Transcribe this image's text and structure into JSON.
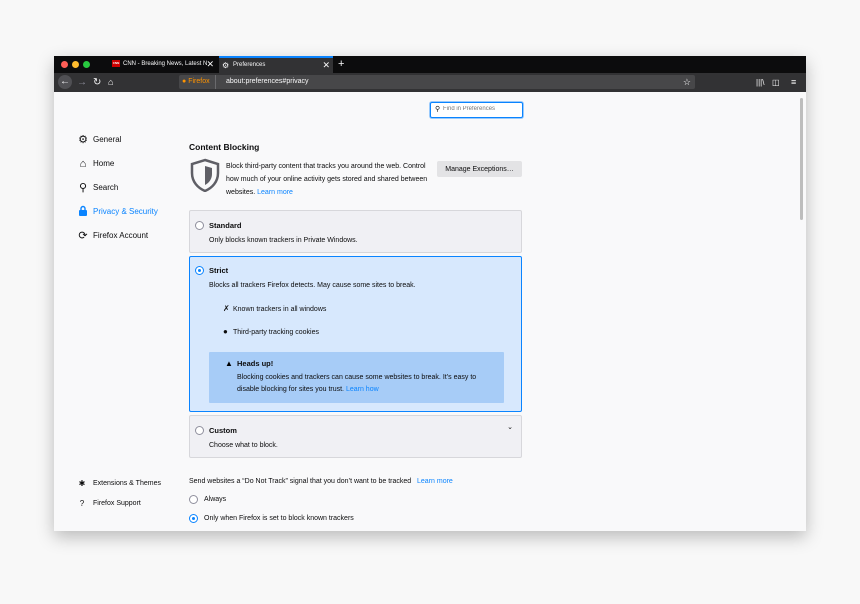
{
  "browser": {
    "tabs": [
      {
        "favicon": "CNN",
        "title": "CNN - Breaking News, Latest N"
      },
      {
        "title": "Preferences"
      }
    ],
    "new_tab": "+",
    "identity": "Firefox",
    "url": "about:preferences#privacy"
  },
  "search": {
    "placeholder": "Find in Preferences"
  },
  "sidebar": {
    "items": [
      {
        "label": "General",
        "icon": "gear-icon"
      },
      {
        "label": "Home",
        "icon": "home-icon"
      },
      {
        "label": "Search",
        "icon": "search-icon"
      },
      {
        "label": "Privacy & Security",
        "icon": "lock-icon"
      },
      {
        "label": "Firefox Account",
        "icon": "sync-icon"
      }
    ],
    "footer": [
      {
        "label": "Extensions & Themes",
        "icon": "puzzle-icon"
      },
      {
        "label": "Firefox Support",
        "icon": "help-icon"
      }
    ]
  },
  "content_blocking": {
    "title": "Content Blocking",
    "description": "Block third-party content that tracks you around the web. Control how much of your online activity gets stored and shared between websites.",
    "learn_more": "Learn more",
    "manage_button": "Manage Exceptions…",
    "standard": {
      "title": "Standard",
      "desc": "Only blocks known trackers in Private Windows."
    },
    "strict": {
      "title": "Strict",
      "desc": "Blocks all trackers Firefox detects. May cause some sites to break.",
      "features": [
        "Known trackers in all windows",
        "Third-party tracking cookies"
      ],
      "warning_title": "Heads up!",
      "warning_text": "Blocking cookies and trackers can cause some websites to break. It’s easy to disable blocking for sites you trust.",
      "warning_link": "Learn how"
    },
    "custom": {
      "title": "Custom",
      "desc": "Choose what to block."
    }
  },
  "dnt": {
    "label": "Send websites a “Do Not Track” signal that you don’t want to be tracked",
    "learn_more": "Learn more",
    "options": [
      "Always",
      "Only when Firefox is set to block known trackers"
    ],
    "selected": 1
  },
  "colors": {
    "accent": "#0a84ff",
    "tabbar": "#0c0c0d",
    "toolbar": "#323234",
    "selected_card": "#d7e8fd",
    "warning_bg": "#a7ccf7"
  }
}
